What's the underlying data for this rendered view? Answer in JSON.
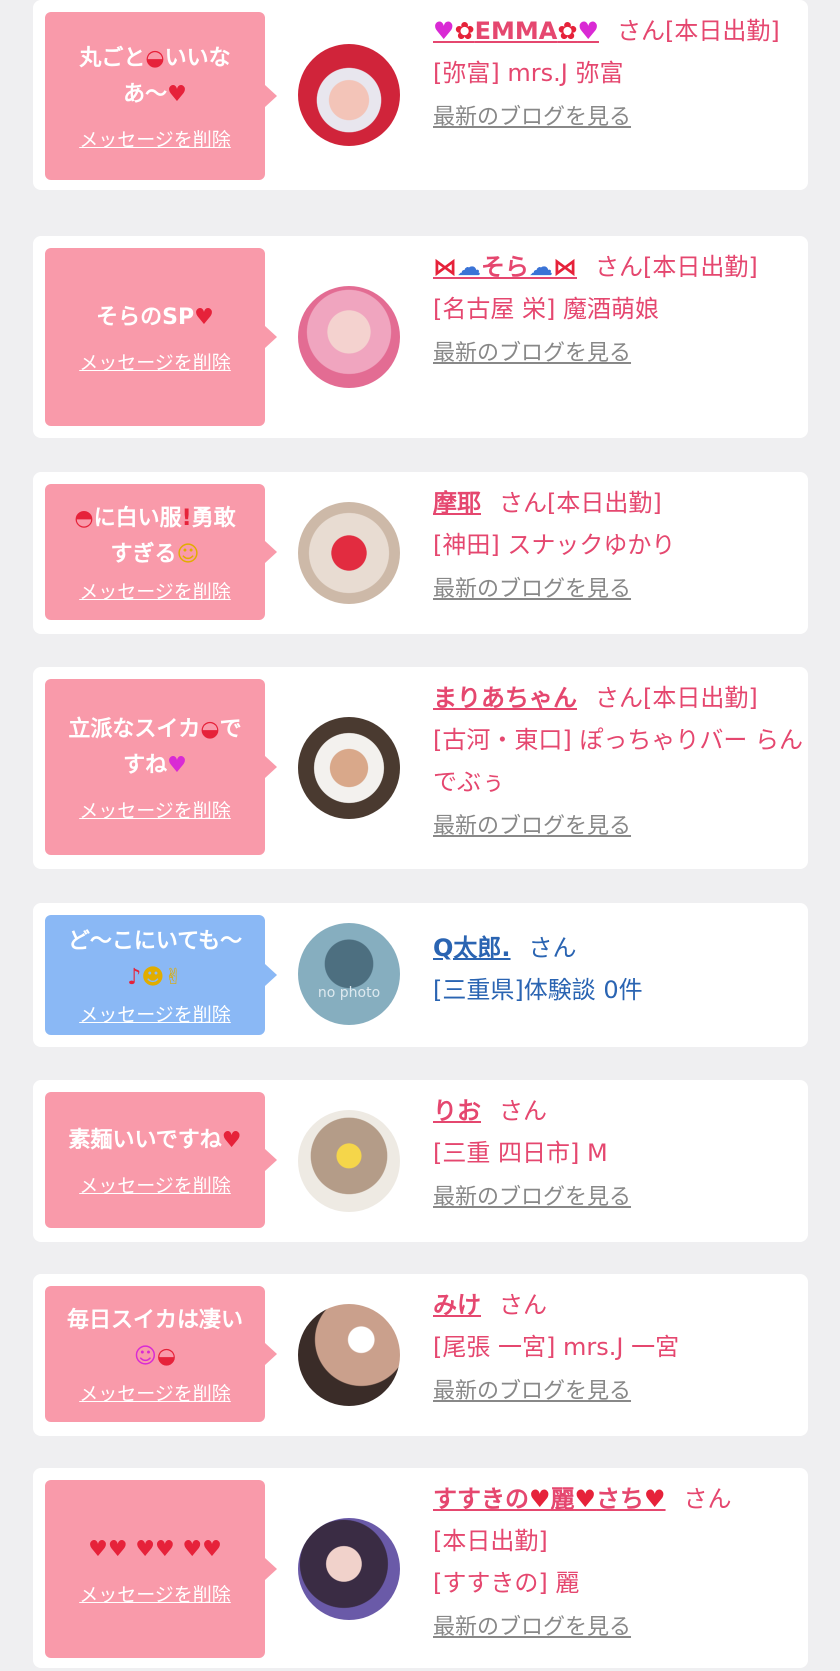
{
  "delete_label": "メッセージを削除",
  "blog_label": "最新のブログを見る",
  "san": "さん",
  "cards": [
    {
      "message_a": "丸ごと",
      "message_b": "いいな",
      "message_c": "あ〜",
      "name_text": "EMMA",
      "status": "[本日出勤]",
      "shop": "[弥富] mrs.J 弥富"
    },
    {
      "message": "そらのSP",
      "name_text": "そら",
      "status": "[本日出勤]",
      "shop": "[名古屋 栄] 魔酒萌娘"
    },
    {
      "message_a": "に白い服",
      "message_b": "勇敢",
      "message_c": "すぎる",
      "name": "摩耶",
      "status": "[本日出勤]",
      "shop": "[神田] スナックゆかり"
    },
    {
      "message_a": "立派なスイカ",
      "message_b": "で",
      "message_c": "すね",
      "name": "まりあちゃん",
      "status": "[本日出勤]",
      "shop": "[古河・東口] ぽっちゃりバー らんでぶぅ"
    },
    {
      "message": "ど〜こにいても〜",
      "name": "Q太郎.",
      "info": "[三重県]体験談 0件",
      "avatar_text": "no photo"
    },
    {
      "message": "素麺いいですね",
      "name": "りお",
      "shop": "[三重 四日市] M"
    },
    {
      "message": "毎日スイカは凄い",
      "name": "みけ",
      "shop": "[尾張 一宮] mrs.J 一宮"
    },
    {
      "name_a": "すすきの",
      "name_b": "麗",
      "name_c": "さち",
      "status": "[本日出勤]",
      "shop": "[すすきの] 麗"
    }
  ],
  "colors": {
    "background": "#efeff1",
    "card": "#ffffff",
    "bubble_pink": "#f99aaa",
    "bubble_blue": "#8ab8f5",
    "accent_pink": "#e5476f",
    "accent_blue": "#2a64b2",
    "link_gray": "#888888"
  },
  "icons": [
    "watermelon-icon",
    "red-heart-icon",
    "purple-heart-icon",
    "rose-icon",
    "ribbon-icon",
    "cloud-icon",
    "hat-icon",
    "exclamation-icon",
    "laughing-face-icon",
    "music-note-icon",
    "star-struck-face-icon",
    "peace-hand-icon",
    "two-hearts-icon",
    "sparkle-face-icon"
  ]
}
